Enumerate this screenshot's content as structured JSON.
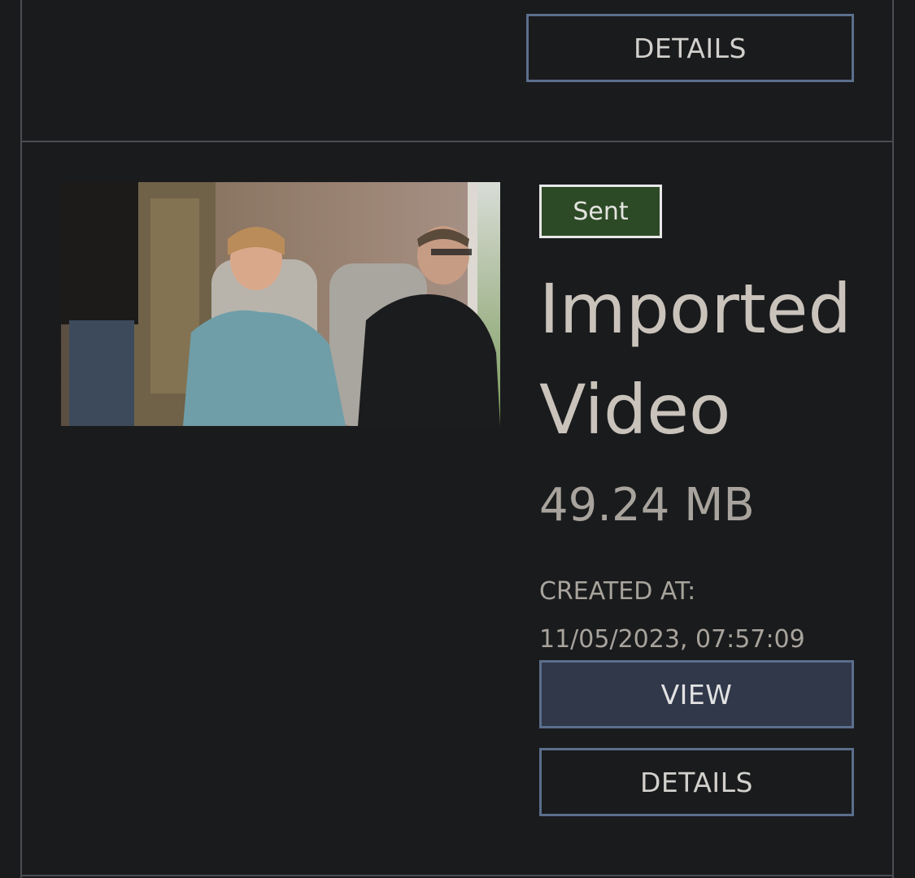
{
  "previous_card": {
    "details_label": "DETAILS"
  },
  "card": {
    "thumbnail": {
      "description_icon": "video-thumbnail"
    },
    "status_badge": "Sent",
    "title": "Imported Video",
    "file_size": "49.24 MB",
    "created_label": "CREATED AT:",
    "created_value": "11/05/2023, 07:57:09",
    "view_label": "VIEW",
    "details_label": "DETAILS"
  },
  "colors": {
    "background": "#1a1b1d",
    "border": "#4a4d53",
    "button_border": "#5b6e8c",
    "view_button_bg": "#30384a",
    "badge_bg": "#2d4a26",
    "text_primary": "#c9c3bb"
  }
}
